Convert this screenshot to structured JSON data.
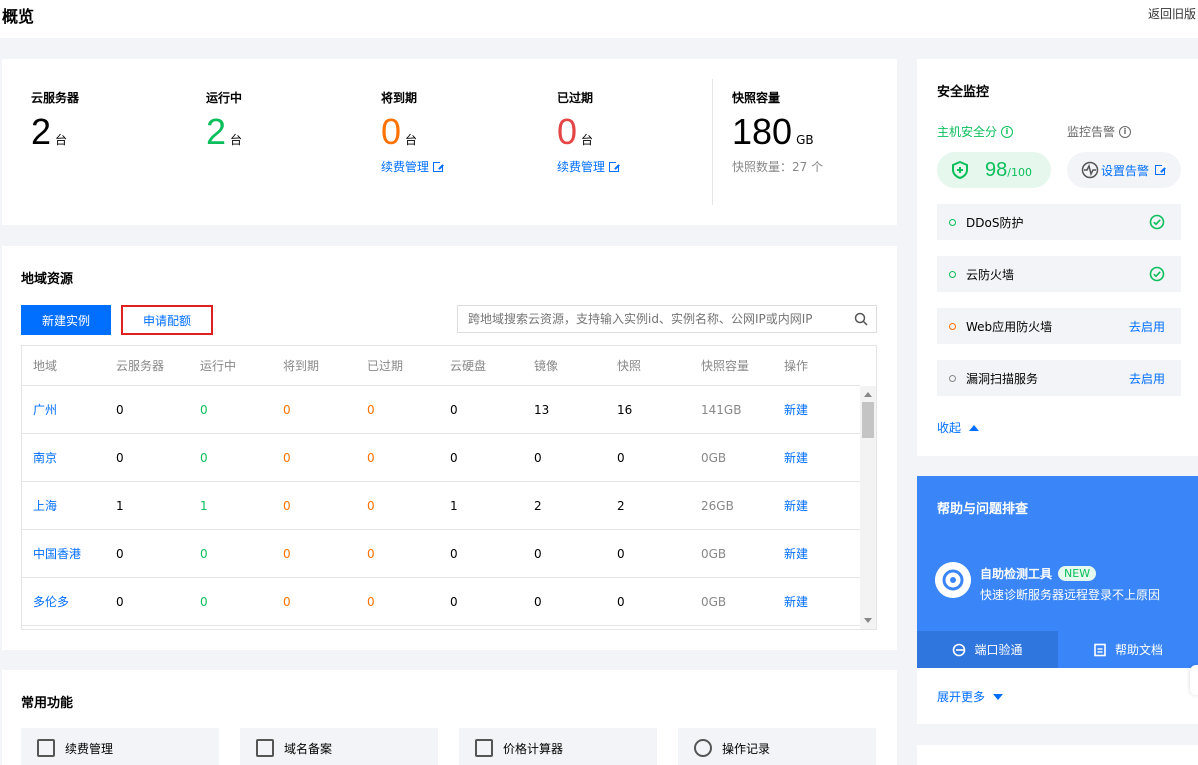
{
  "header": {
    "title": "概览",
    "back_link": "返回旧版"
  },
  "stats": {
    "items": [
      {
        "label": "云服务器",
        "value": "2",
        "unit": "台",
        "color": "#000000"
      },
      {
        "label": "运行中",
        "value": "2",
        "unit": "台",
        "color": "#0abf5b"
      },
      {
        "label": "将到期",
        "value": "0",
        "unit": "台",
        "color": "#ff7200",
        "link": "续费管理"
      },
      {
        "label": "已过期",
        "value": "0",
        "unit": "台",
        "color": "#e54545",
        "link": "续费管理"
      },
      {
        "label": "快照容量",
        "value": "180",
        "unit": "GB",
        "color": "#000000",
        "sub": "快照数量：27 个"
      }
    ]
  },
  "region": {
    "title": "地域资源",
    "new_instance": "新建实例",
    "apply_quota": "申请配额",
    "search_placeholder": "跨地域搜索云资源，支持输入实例id、实例名称、公网IP或内网IP",
    "columns": [
      "地域",
      "云服务器",
      "运行中",
      "将到期",
      "已过期",
      "云硬盘",
      "镜像",
      "快照",
      "快照容量",
      "操作"
    ],
    "rows": [
      {
        "region": "广州",
        "cvm": "0",
        "running": "0",
        "expiring": "0",
        "expired": "0",
        "cbs": "0",
        "image": "13",
        "snapshot": "16",
        "capacity": "141GB",
        "action": "新建"
      },
      {
        "region": "南京",
        "cvm": "0",
        "running": "0",
        "expiring": "0",
        "expired": "0",
        "cbs": "0",
        "image": "0",
        "snapshot": "0",
        "capacity": "0GB",
        "action": "新建"
      },
      {
        "region": "上海",
        "cvm": "1",
        "running": "1",
        "expiring": "0",
        "expired": "0",
        "cbs": "1",
        "image": "2",
        "snapshot": "2",
        "capacity": "26GB",
        "action": "新建"
      },
      {
        "region": "中国香港",
        "cvm": "0",
        "running": "0",
        "expiring": "0",
        "expired": "0",
        "cbs": "0",
        "image": "0",
        "snapshot": "0",
        "capacity": "0GB",
        "action": "新建"
      },
      {
        "region": "多伦多",
        "cvm": "0",
        "running": "0",
        "expiring": "0",
        "expired": "0",
        "cbs": "0",
        "image": "0",
        "snapshot": "0",
        "capacity": "0GB",
        "action": "新建"
      }
    ]
  },
  "common": {
    "title": "常用功能",
    "items": [
      {
        "label": "续费管理",
        "icon": "renew-icon"
      },
      {
        "label": "域名备案",
        "icon": "domain-icon"
      },
      {
        "label": "价格计算器",
        "icon": "calculator-icon"
      },
      {
        "label": "操作记录",
        "icon": "history-icon"
      }
    ]
  },
  "security": {
    "title": "安全监控",
    "score_label": "主机安全分",
    "alarm_label": "监控告警",
    "score": "98",
    "score_total": "/100",
    "alarm_button": "设置告警",
    "items": [
      {
        "label": "DDoS防护",
        "status": "ok"
      },
      {
        "label": "云防火墙",
        "status": "ok"
      },
      {
        "label": "Web应用防火墙",
        "status": "warn",
        "action": "去启用"
      },
      {
        "label": "漏洞扫描服务",
        "status": "off",
        "action": "去启用"
      }
    ],
    "collapse": "收起"
  },
  "help": {
    "title": "帮助与问题排查",
    "tool_title": "自助检测工具",
    "badge": "NEW",
    "tool_desc": "快速诊断服务器远程登录不上原因",
    "tab_port": "端口验通",
    "tab_docs": "帮助文档",
    "expand": "展开更多"
  }
}
